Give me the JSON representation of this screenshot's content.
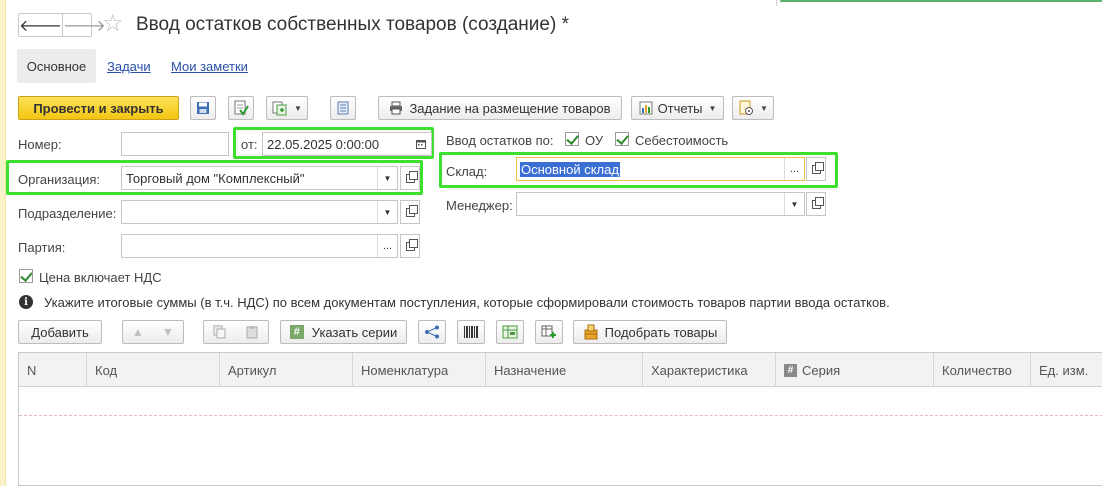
{
  "window": {
    "title": "Ввод остатков собственных товаров (создание) *"
  },
  "nav": {
    "back_icon": "arrow-left-icon",
    "forward_icon": "arrow-right-icon",
    "favorite_icon": "star-icon"
  },
  "tabs": [
    {
      "label": "Основное",
      "active": true
    },
    {
      "label": "Задачи",
      "active": false
    },
    {
      "label": "Мои заметки",
      "active": false
    }
  ],
  "toolbar": {
    "post_close_label": "Провести и закрыть",
    "placement_task_label": "Задание на размещение товаров",
    "reports_label": "Отчеты"
  },
  "form": {
    "number_label": "Номер:",
    "number_value": "",
    "date_label": "от:",
    "date_value": "22.05.2025  0:00:00",
    "organization_label": "Организация:",
    "organization_value": "Торговый дом \"Комплексный\"",
    "division_label": "Подразделение:",
    "division_value": "",
    "batch_label": "Партия:",
    "batch_value": "",
    "price_vat_label": "Цена включает НДС",
    "price_vat_checked": true,
    "input_by_label": "Ввод остатков по:",
    "ou_label": "ОУ",
    "ou_checked": true,
    "cost_label": "Себестоимость",
    "cost_checked": true,
    "warehouse_label": "Склад:",
    "warehouse_value": "Основной склад",
    "manager_label": "Менеджер:",
    "manager_value": ""
  },
  "info": {
    "text": "Укажите итоговые суммы (в т.ч. НДС) по всем документам поступления, которые сформировали стоимость товаров партии ввода остатков."
  },
  "table_toolbar": {
    "add_label": "Добавить",
    "series_label": "Указать серии",
    "pick_goods_label": "Подобрать товары"
  },
  "table": {
    "columns": [
      "N",
      "Код",
      "Артикул",
      "Номенклатура",
      "Назначение",
      "Характеристика",
      "Серия",
      "Количество",
      "Ед. изм."
    ]
  },
  "colors": {
    "highlight": "#3ee02f",
    "primary_button": "#f3c511",
    "link": "#2a4fa8",
    "selection": "#3b6fd4",
    "focus_border": "#f0c43a"
  }
}
